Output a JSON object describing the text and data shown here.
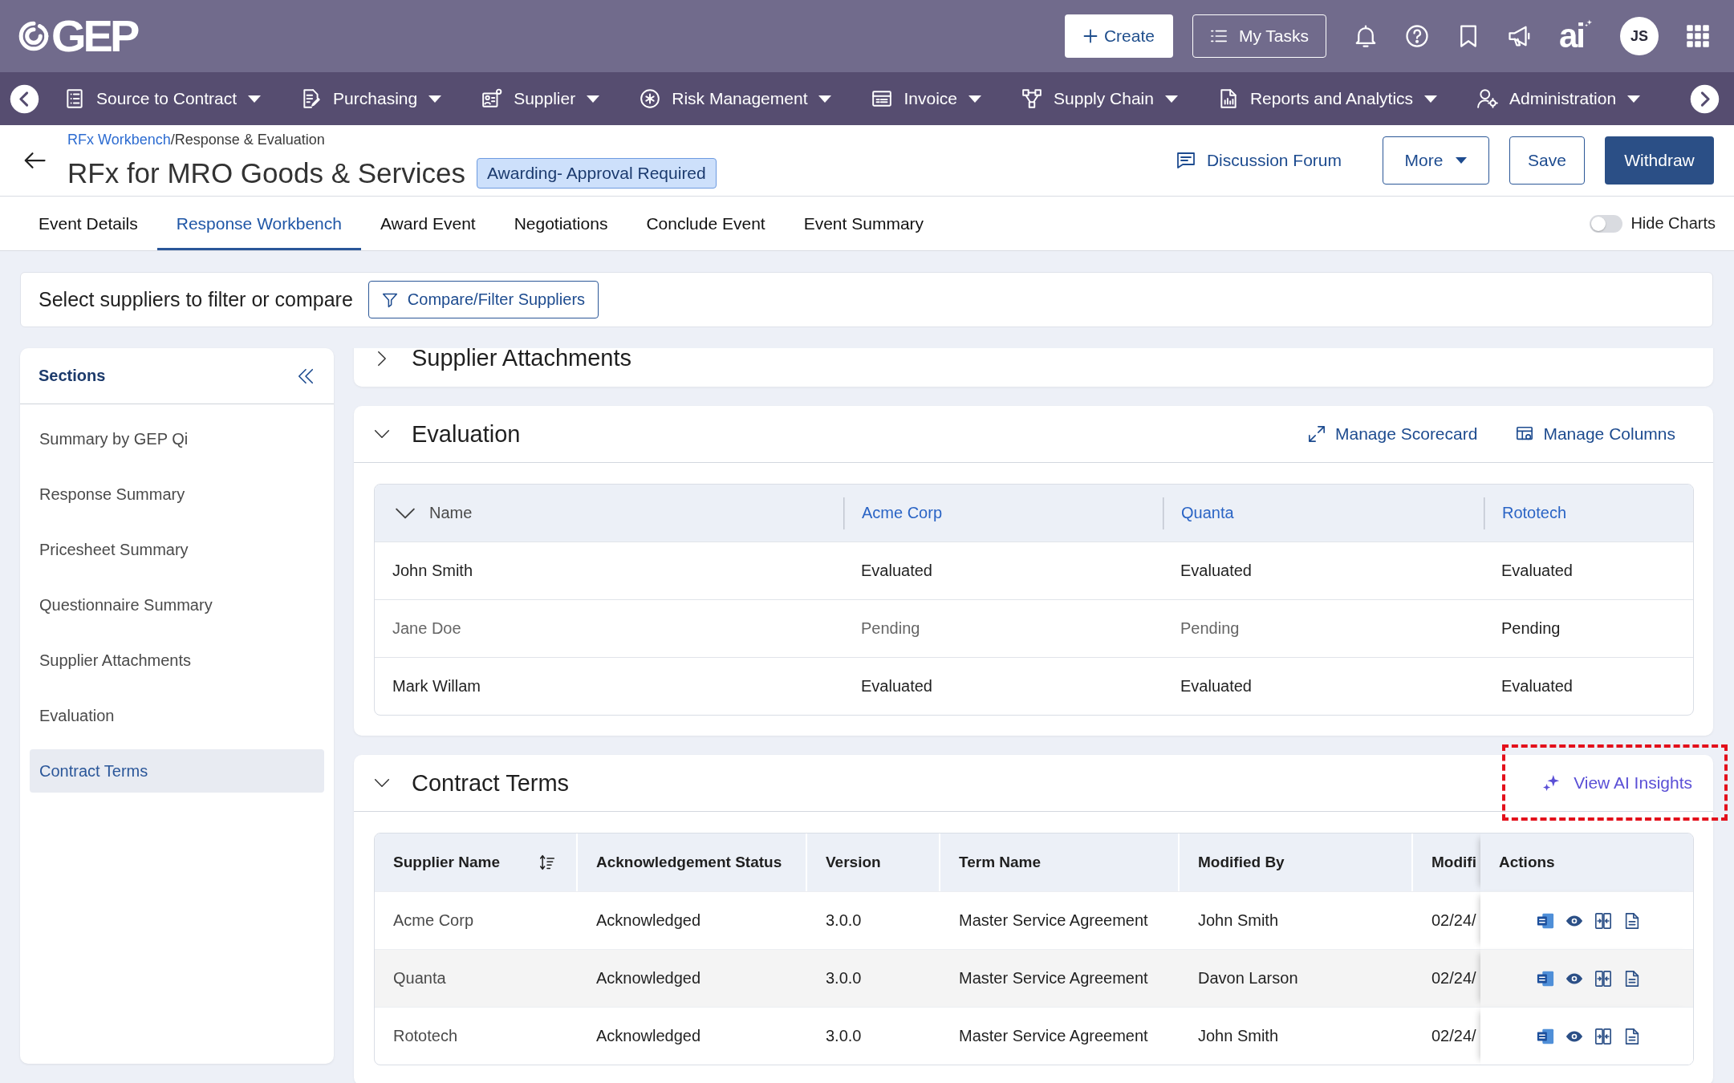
{
  "top_bar": {
    "logo": "GEP",
    "create_button": "Create",
    "tasks_button": "My Tasks",
    "ai_logo": "ai",
    "avatar_initials": "JS"
  },
  "nav_menu": [
    "Source to Contract",
    "Purchasing",
    "Supplier",
    "Risk Management",
    "Invoice",
    "Supply Chain",
    "Reports and Analytics",
    "Administration"
  ],
  "breadcrumb": {
    "link": "RFx Workbench",
    "current": "/Response & Evaluation"
  },
  "title": "RFx for MRO Goods & Services",
  "status_badge": "Awarding- Approval Required",
  "header_actions": {
    "discussion_forum": "Discussion Forum",
    "more": "More",
    "save": "Save",
    "withdraw": "Withdraw"
  },
  "tabs": [
    {
      "label": "Event Details",
      "selected": false
    },
    {
      "label": "Response Workbench",
      "selected": true
    },
    {
      "label": "Award Event",
      "selected": false
    },
    {
      "label": "Negotiations",
      "selected": false
    },
    {
      "label": "Conclude Event",
      "selected": false
    },
    {
      "label": "Event Summary",
      "selected": false
    }
  ],
  "hide_charts": {
    "label": "Hide Charts",
    "on": false
  },
  "filter_bar": {
    "prompt": "Select suppliers to filter or compare",
    "button": "Compare/Filter Suppliers"
  },
  "sidebar": {
    "title": "Sections",
    "items": [
      {
        "label": "Summary by GEP Qi",
        "selected": false
      },
      {
        "label": "Response Summary",
        "selected": false
      },
      {
        "label": "Pricesheet Summary",
        "selected": false
      },
      {
        "label": "Questionnaire Summary",
        "selected": false
      },
      {
        "label": "Supplier Attachments",
        "selected": false
      },
      {
        "label": "Evaluation",
        "selected": false
      },
      {
        "label": "Contract Terms",
        "selected": true
      }
    ]
  },
  "sections": [
    {
      "title": "Supplier Attachments",
      "expanded": false
    },
    {
      "title": "Evaluation",
      "expanded": true,
      "links": [
        {
          "label": "Manage Scorecard",
          "kind": "scorecard",
          "highlighted": false
        },
        {
          "label": "Manage Columns",
          "kind": "columns",
          "highlighted": false
        }
      ],
      "table": {
        "kind": "matrix",
        "columns": [
          {
            "label": "Name",
            "kind": "name"
          },
          {
            "label": "Acme Corp",
            "kind": "supplier"
          },
          {
            "label": "Quanta",
            "kind": "supplier"
          },
          {
            "label": "Rototech",
            "kind": "supplier"
          }
        ],
        "rows": [
          {
            "cells": [
              {
                "text": "John Smith",
                "dimmed": false
              },
              {
                "text": "Evaluated",
                "dimmed": false
              },
              {
                "text": "Evaluated",
                "dimmed": false
              },
              {
                "text": "Evaluated",
                "dimmed": false
              }
            ]
          },
          {
            "cells": [
              {
                "text": "Jane Doe",
                "dimmed": true
              },
              {
                "text": "Pending",
                "dimmed": true
              },
              {
                "text": "Pending",
                "dimmed": true
              },
              {
                "text": "Pending",
                "dimmed": false
              }
            ]
          },
          {
            "cells": [
              {
                "text": "Mark Willam",
                "dimmed": false
              },
              {
                "text": "Evaluated",
                "dimmed": false
              },
              {
                "text": "Evaluated",
                "dimmed": false
              },
              {
                "text": "Evaluated",
                "dimmed": false
              }
            ]
          }
        ]
      }
    },
    {
      "title": "Contract Terms",
      "expanded": true,
      "links": [
        {
          "label": "View AI Insights",
          "kind": "insights",
          "highlighted": true
        }
      ],
      "table": {
        "kind": "terms",
        "columns": [
          {
            "label": "Supplier Name",
            "sortable": true
          },
          {
            "label": "Acknowledgement Status",
            "sortable": false
          },
          {
            "label": "Version",
            "sortable": false
          },
          {
            "label": "Term Name",
            "sortable": false
          },
          {
            "label": "Modified By",
            "sortable": false
          },
          {
            "label": "Modifi",
            "sortable": false
          },
          {
            "label": "Actions",
            "sortable": false
          }
        ],
        "rows": [
          {
            "cells": [
              "Acme Corp",
              "Acknowledged",
              "3.0.0",
              "Master Service Agreement",
              "John Smith",
              "02/24/"
            ],
            "hovered": false
          },
          {
            "cells": [
              "Quanta",
              "Acknowledged",
              "3.0.0",
              "Master Service Agreement",
              "Davon Larson",
              "02/24/"
            ],
            "hovered": true
          },
          {
            "cells": [
              "Rototech",
              "Acknowledged",
              "3.0.0",
              "Master Service Agreement",
              "John Smith",
              "02/24/"
            ],
            "hovered": false
          }
        ]
      }
    }
  ]
}
